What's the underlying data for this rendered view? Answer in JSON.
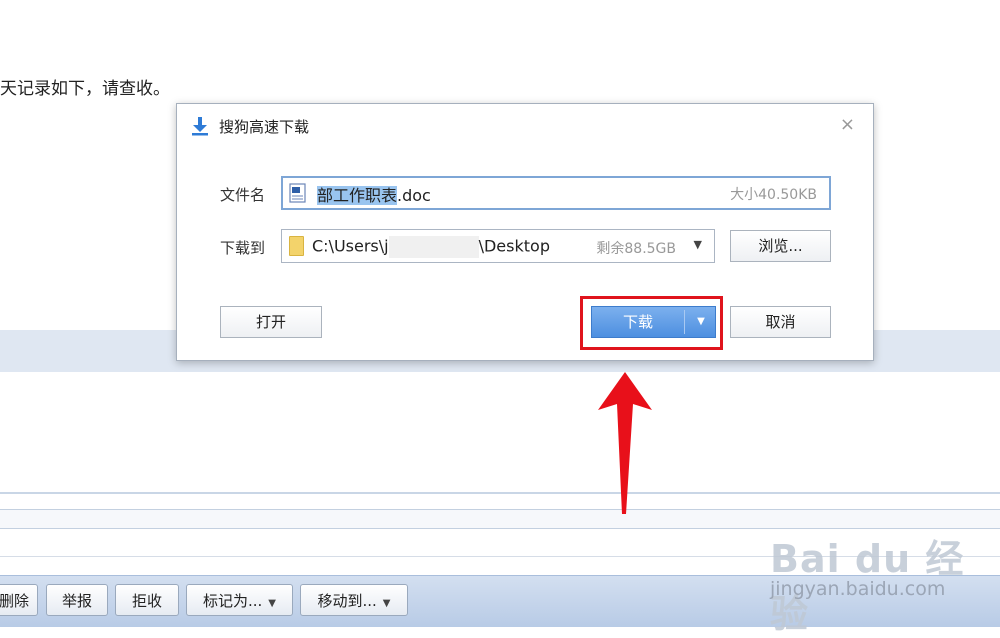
{
  "background": {
    "message_text": "天记录如下，请查收。"
  },
  "toolbar": {
    "buttons": [
      {
        "label": "删除"
      },
      {
        "label": "举报"
      },
      {
        "label": "拒收"
      },
      {
        "label": "标记为..."
      },
      {
        "label": "移动到..."
      }
    ]
  },
  "dialog": {
    "title": "搜狗高速下载",
    "close_glyph": "×",
    "filename_label": "文件名",
    "filename_selected": "部工作职表",
    "filename_ext": ".doc",
    "file_size": "大小40.50KB",
    "save_to_label": "下载到",
    "path_prefix": "C:\\Users\\j",
    "path_suffix": "\\Desktop",
    "free_space": "剩余88.5GB",
    "browse_label": "浏览...",
    "open_label": "打开",
    "download_label": "下载",
    "cancel_label": "取消"
  },
  "watermark": {
    "logo_text": "Bai du 经验",
    "url": "jingyan.baidu.com"
  },
  "colors": {
    "accent_blue": "#4d8fe0",
    "highlight_red": "#e0141d",
    "arrow_red": "#e8101a"
  }
}
